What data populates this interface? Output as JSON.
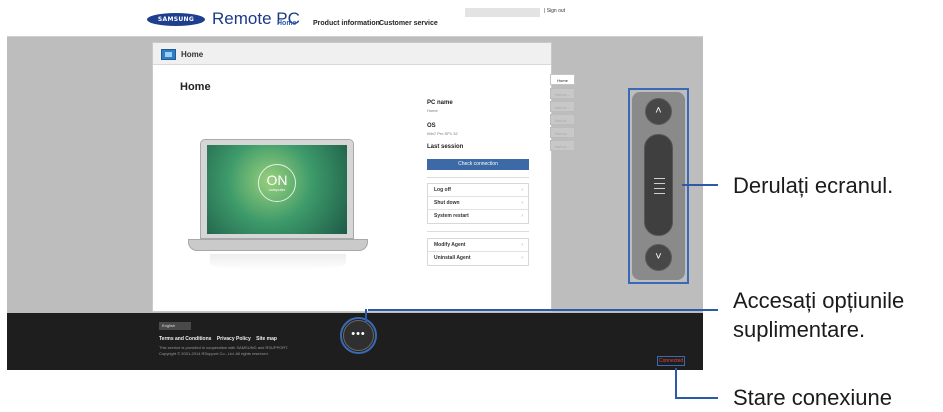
{
  "header": {
    "brand_logo_text": "SAMSUNG",
    "app_title": "Remote PC",
    "nav": [
      {
        "label": "Home"
      },
      {
        "label": "Product information"
      },
      {
        "label": "Customer service"
      }
    ],
    "signout_label": "| Sign out"
  },
  "panel": {
    "header_label": "Home",
    "title": "Home",
    "on_label": "ON",
    "on_sub_label": "computer",
    "pc_name_label": "PC name",
    "pc_name_value": "Home",
    "os_label": "OS",
    "os_value": "Win7 Pro SP1 32",
    "last_session_label": "Last session",
    "check_connection_label": "Check connection",
    "power_menu": [
      {
        "label": "Log off"
      },
      {
        "label": "Shut down"
      },
      {
        "label": "System restart"
      }
    ],
    "agent_menu": [
      {
        "label": "Modify Agent"
      },
      {
        "label": "Uninstall Agent"
      }
    ]
  },
  "tabs": {
    "active_label": "Home",
    "dim_labels": [
      "Not co...",
      "Not co...",
      "Not co...",
      "Not co...",
      "Not co..."
    ]
  },
  "scroll": {
    "up_glyph": "˄",
    "down_glyph": "˅"
  },
  "footer": {
    "language_label": "English",
    "links": [
      "Terms and Conditions",
      "Privacy Policy",
      "Site map"
    ],
    "note_line1": "This service is provided in cooperation with SAMSUNG and RSUPPORT.",
    "note_line2": "Copyright © 2001-2014 RSupport Co., Ltd. All rights reserved.",
    "more_glyph": "•••",
    "connection_status": "Connected"
  },
  "callouts": {
    "scroll_label": "Derulați ecranul.",
    "more_line1": "Accesați opțiunile",
    "more_line2": "suplimentare.",
    "status_label": "Stare conexiune"
  },
  "colors": {
    "callout_line": "#2b5aa8",
    "brand_blue": "#1b3a86",
    "connected_red": "#e14a3c"
  },
  "icons": {
    "home": "home-icon",
    "scroll_up": "chevron-up-icon",
    "scroll_down": "chevron-down-icon",
    "more": "more-options-icon",
    "menu_arrow": "chevron-right-icon"
  }
}
